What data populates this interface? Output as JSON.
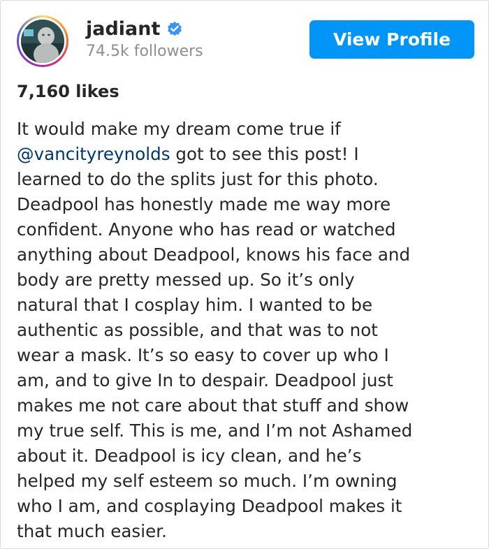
{
  "post": {
    "username": "jadiant",
    "verified": true,
    "followers": "74.5k followers",
    "view_profile_label": "View Profile",
    "likes": "7,160 likes",
    "caption": {
      "line1_prefix": "It would make my dream come true if",
      "mention": "@vancityreynolds",
      "rest": " got to see this post! I\nlearned to do the splits just for this photo.\nDeadpool has honestly made me way more\nconfident. Anyone who has read or watched\nanything about Deadpool, knows his face and\nbody are pretty messed up. So it’s only\nnatural that I cosplay him. I wanted to be\nauthentic as possible, and that was to not\nwear a mask. It’s so easy to cover up who I\nam, and to give In to despair. Deadpool just\nmakes me not care about that stuff and show\nmy true self. This is me, and I’m not Ashamed\nabout it. Deadpool is icy clean, and he’s\nhelped my self esteem so much. I’m owning\nwho I am, and cosplaying Deadpool makes it\nthat much easier."
    }
  },
  "icons": {
    "verified": "verified-badge-icon",
    "avatar": "profile-avatar"
  },
  "colors": {
    "button_bg": "#0095f6",
    "mention": "#00376b",
    "verified": "#3897f0",
    "secondary_text": "#8e8e8e"
  }
}
